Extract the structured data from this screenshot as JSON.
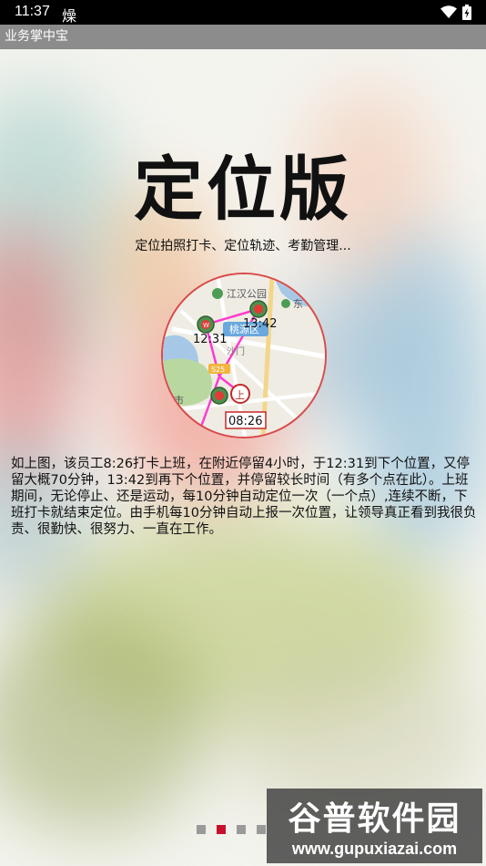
{
  "status_bar": {
    "time": "11:37",
    "notification": "燥",
    "wifi_icon": "wifi-icon",
    "battery_icon": "battery-charging-icon"
  },
  "app_title": "业务掌中宝",
  "headline": "定位版",
  "subtitle": "定位拍照打卡、定位轨迹、考勤管理...",
  "map_preview": {
    "place_labels": [
      "江汉公园",
      "东",
      "桃源区",
      "沙门",
      "市"
    ],
    "road_badge": "S25",
    "time_labels": [
      "12:31",
      "13:42",
      "08:26"
    ],
    "start_marker_label": "上",
    "waypoint_marker_label": "W"
  },
  "description": "如上图，该员工8:26打卡上班，在附近停留4小时，于12:31到下个位置，又停留大概70分钟，13:42到再下个位置，并停留较长时间（有多个点在此）。上班期间，无论停止、还是运动，每10分钟自动定位一次（一个点）,连续不断，下班打卡就结束定位。由手机每10分钟自动上报一次位置，让领导真正看到我很负责、很勤快、很努力、一直在工作。",
  "page_indicator": {
    "total": 4,
    "active_index": 1
  },
  "watermark": {
    "title": "谷普软件园",
    "url": "www.gupuxiazai.com"
  }
}
